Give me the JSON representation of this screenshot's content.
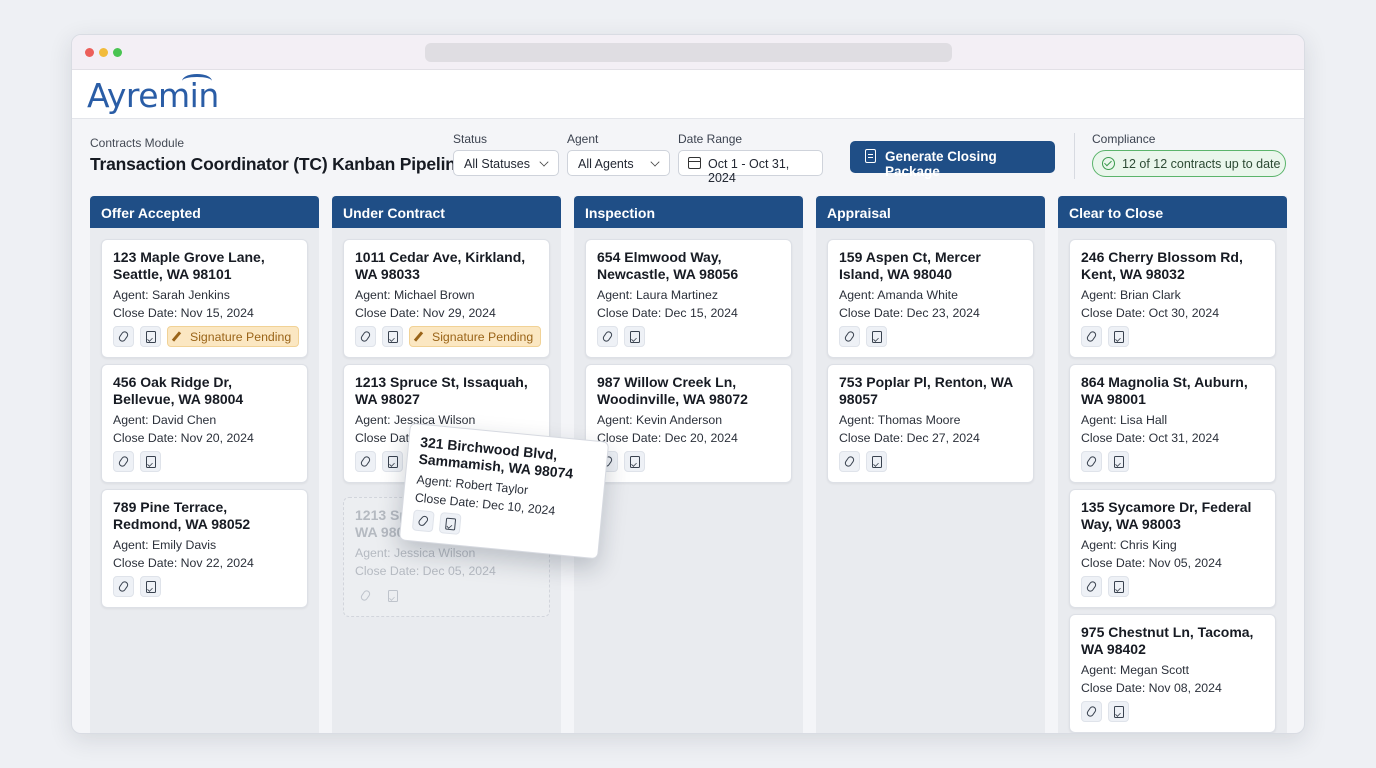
{
  "app": {
    "logo_text": "Ayremin"
  },
  "header": {
    "module_label": "Contracts Module",
    "title": "Transaction Coordinator (TC) Kanban Pipeline"
  },
  "filters": {
    "status": {
      "label": "Status",
      "value": "All Statuses"
    },
    "agent": {
      "label": "Agent",
      "value": "All Agents"
    },
    "date_range": {
      "label": "Date Range",
      "value": "Oct 1 - Oct 31, 2024"
    }
  },
  "actions": {
    "generate_label": "Generate Closing Package"
  },
  "compliance": {
    "label": "Compliance",
    "status_text": "12 of 12 contracts up to date",
    "color": "#3a9a4c"
  },
  "colors": {
    "primary": "#1f4e86",
    "warning_bg": "#fbe7c2",
    "warning_text": "#9a6418"
  },
  "columns": [
    {
      "title": "Offer Accepted",
      "cards": [
        {
          "address": "123 Maple Grove Lane, Seattle, WA 98101",
          "agent": "Agent: Sarah Jenkins",
          "close_date": "Close Date: Nov 15, 2024",
          "badge": "Signature Pending"
        },
        {
          "address": "456 Oak Ridge Dr, Bellevue, WA 98004",
          "agent": "Agent: David Chen",
          "close_date": "Close Date: Nov 20, 2024",
          "badge": null
        },
        {
          "address": "789 Pine Terrace, Redmond, WA 98052",
          "agent": "Agent: Emily Davis",
          "close_date": "Close Date: Nov 22, 2024",
          "badge": null
        }
      ]
    },
    {
      "title": "Under Contract",
      "cards": [
        {
          "address": "1011 Cedar Ave, Kirkland, WA 98033",
          "agent": "Agent: Michael Brown",
          "close_date": "Close Date: Nov 29, 2024",
          "badge": "Signature Pending"
        },
        {
          "address": "1213 Spruce St, Issaquah, WA 98027",
          "agent": "Agent: Jessica Wilson",
          "close_date": "Close Date: Dec 05, 2024",
          "badge": null
        }
      ],
      "placeholder": {
        "address": "1213 Spruce St, Issaquah, WA 98027",
        "agent": "Agent: Jessica Wilson",
        "close_date": "Close Date: Dec 05, 2024"
      }
    },
    {
      "title": "Inspection",
      "cards": [
        {
          "address": "654 Elmwood Way, Newcastle, WA 98056",
          "agent": "Agent: Laura Martinez",
          "close_date": "Close Date: Dec 15, 2024",
          "badge": null
        },
        {
          "address": "987 Willow Creek Ln, Woodinville, WA 98072",
          "agent": "Agent: Kevin Anderson",
          "close_date": "Close Date: Dec 20, 2024",
          "badge": null
        }
      ]
    },
    {
      "title": "Appraisal",
      "cards": [
        {
          "address": "159 Aspen Ct, Mercer Island, WA 98040",
          "agent": "Agent: Amanda White",
          "close_date": "Close Date: Dec 23, 2024",
          "badge": null
        },
        {
          "address": "753 Poplar Pl, Renton, WA 98057",
          "agent": "Agent: Thomas Moore",
          "close_date": "Close Date: Dec 27, 2024",
          "badge": null
        }
      ]
    },
    {
      "title": "Clear to Close",
      "cards": [
        {
          "address": "246 Cherry Blossom Rd, Kent, WA 98032",
          "agent": "Agent: Brian Clark",
          "close_date": "Close Date: Oct 30, 2024",
          "badge": null
        },
        {
          "address": "864 Magnolia St, Auburn, WA 98001",
          "agent": "Agent: Lisa Hall",
          "close_date": "Close Date: Oct 31, 2024",
          "badge": null
        },
        {
          "address": "135 Sycamore Dr, Federal Way, WA 98003",
          "agent": "Agent: Chris King",
          "close_date": "Close Date: Nov 05, 2024",
          "badge": null
        },
        {
          "address": "975 Chestnut Ln, Tacoma, WA 98402",
          "agent": "Agent: Megan Scott",
          "close_date": "Close Date: Nov 08, 2024",
          "badge": null
        }
      ]
    }
  ],
  "dragging_card": {
    "address": "321 Birchwood Blvd, Sammamish, WA 98074",
    "agent": "Agent: Robert Taylor",
    "close_date": "Close Date: Dec 10, 2024"
  },
  "icons": {
    "attachment": "paperclip-icon",
    "document": "document-check-icon",
    "signature": "pen-icon"
  }
}
